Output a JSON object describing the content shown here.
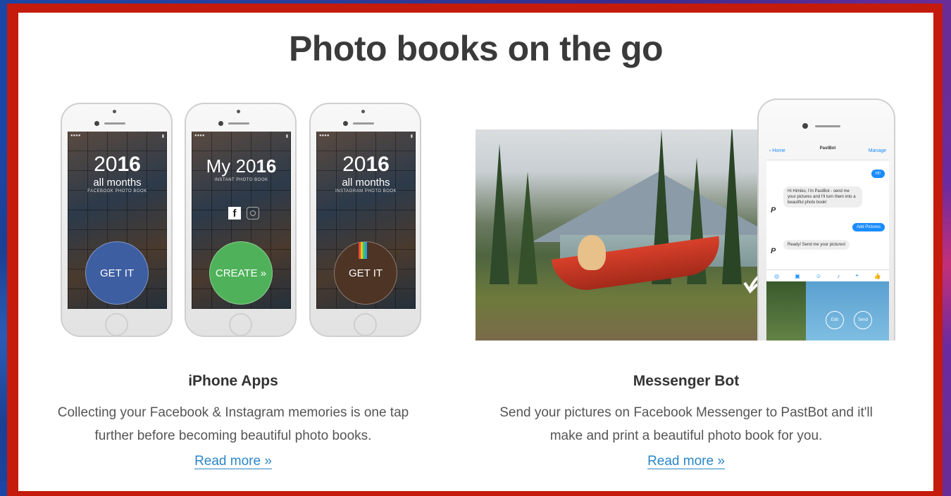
{
  "page_title": "Photo books on the go",
  "apps": {
    "title": "iPhone Apps",
    "description_line1": "Collecting your Facebook & Instagram memories is one tap",
    "description_line2": "further before becoming beautiful photo books.",
    "read_more": "Read more »",
    "phones": [
      {
        "year_prefix": "20",
        "year_suffix": "16",
        "subtitle": "all months",
        "caption": "FACEBOOK PHOTO BOOK",
        "button": "GET IT",
        "button_color": "#3e5ea2"
      },
      {
        "year_prefix": "My 20",
        "year_suffix": "16",
        "subtitle": "",
        "caption": "INSTANT PHOTO BOOK",
        "button": "CREATE »",
        "button_color": "#4fb25a"
      },
      {
        "year_prefix": "20",
        "year_suffix": "16",
        "subtitle": "all months",
        "caption": "INSTAGRAM PHOTO BOOK",
        "button": "GET IT",
        "button_color": "#4e3424"
      }
    ]
  },
  "bot": {
    "title": "Messenger Bot",
    "description_line1": "Send your pictures on Facebook Messenger to PastBot and it'll",
    "description_line2": "make and print a beautiful photo book for you.",
    "read_more": "Read more »",
    "messenger": {
      "back": "Home",
      "contact": "PastBot",
      "manage": "Manage",
      "hi": "Hi!",
      "bot_msg": "Hi Himiko, I'm PastBot - send me your pictures and I'll turn them into a beautiful photo book!",
      "add_pictures": "Add Pictures",
      "ready_msg": "Ready! Send me your pictures!",
      "edit": "Edit",
      "send": "Send"
    }
  },
  "colors": {
    "frame": "#c41b0c",
    "link": "#2a86c9",
    "title": "#3a3a3a"
  }
}
